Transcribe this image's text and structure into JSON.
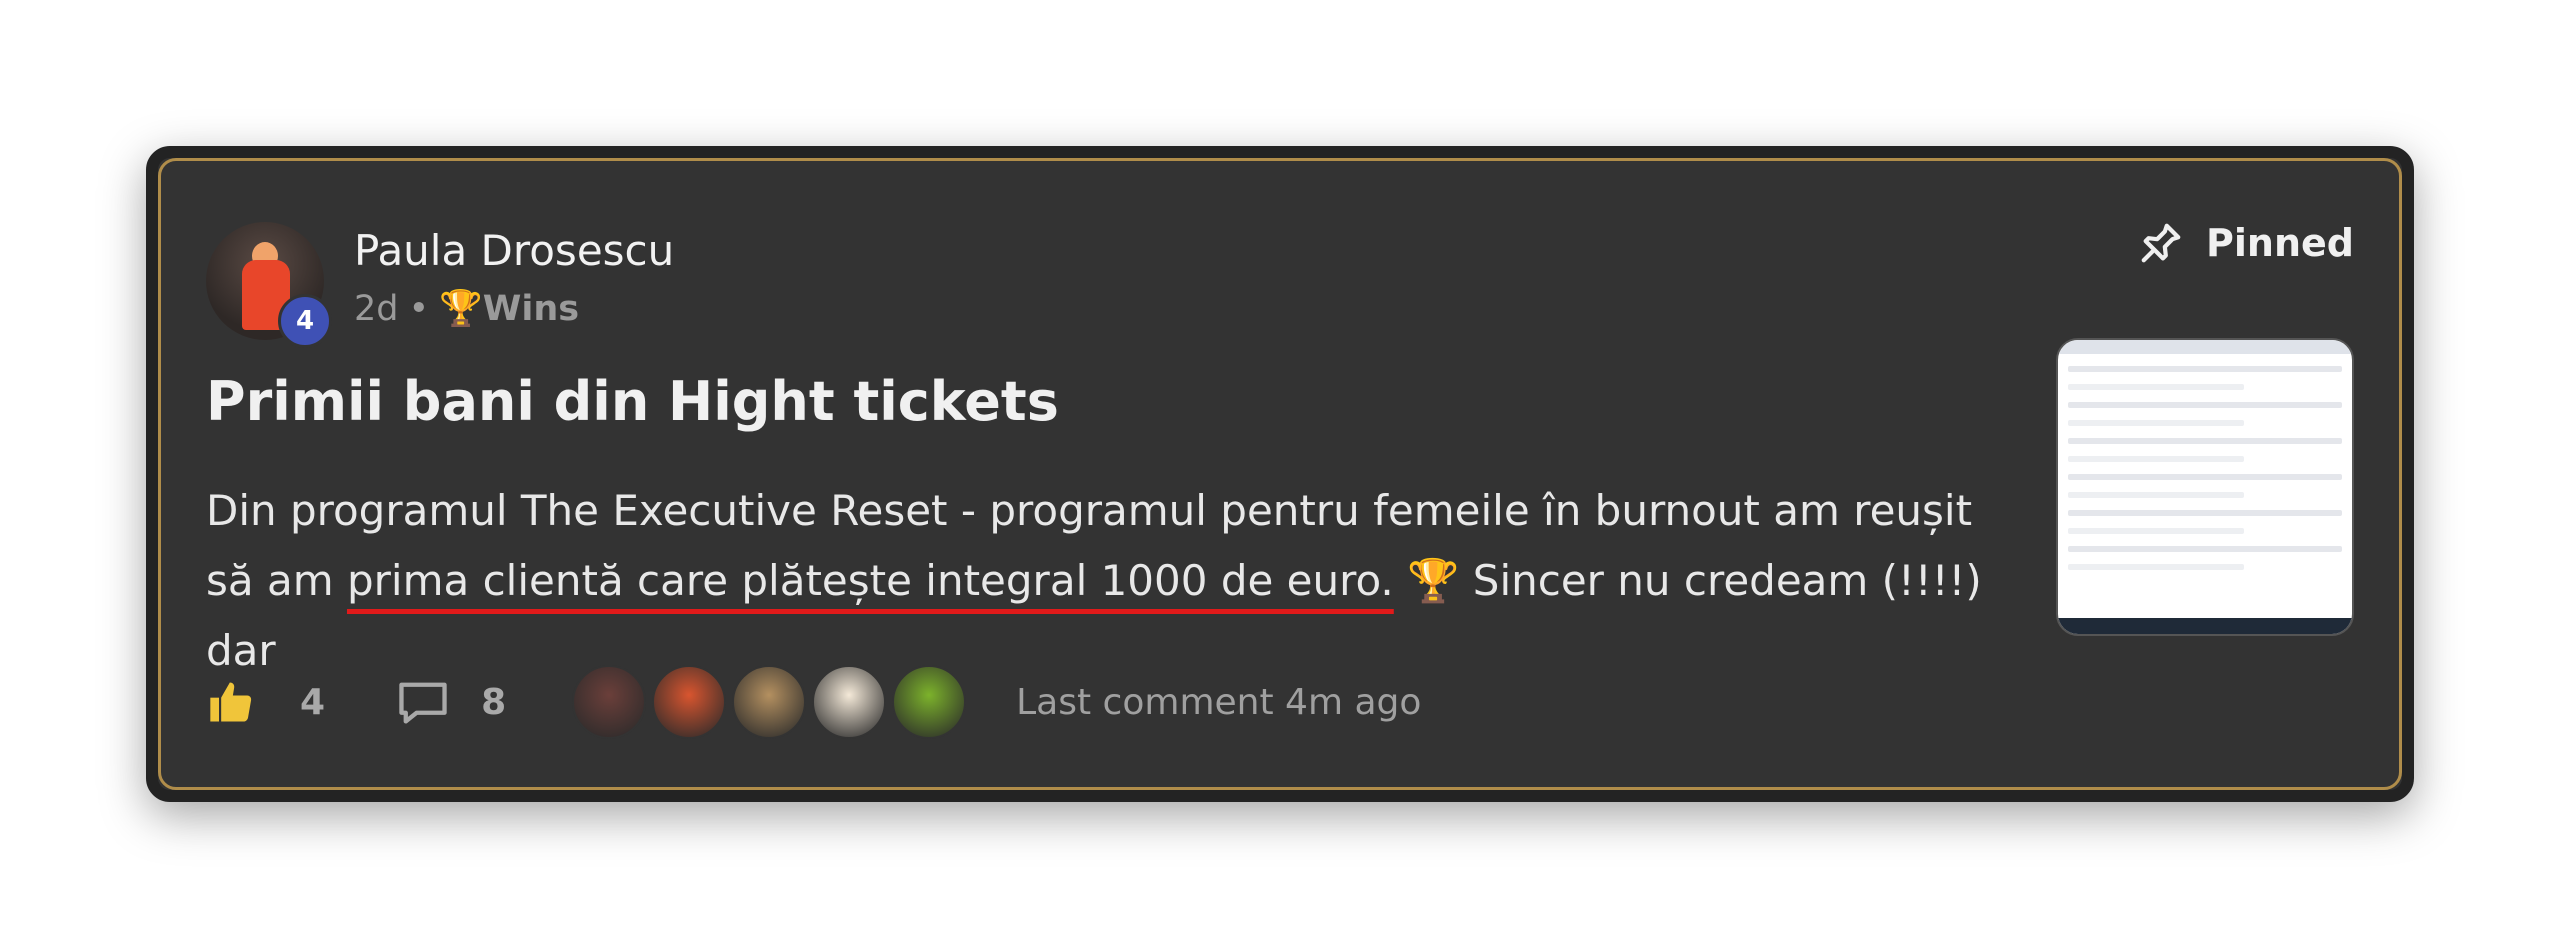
{
  "post": {
    "author": "Paula Drosescu",
    "level": "4",
    "time": "2d",
    "separator": "•",
    "category_emoji": "🏆",
    "category": "Wins",
    "pinned_label": "Pinned",
    "title": "Primii bani din Hight tickets",
    "body_line1": "Din programul The Executive Reset - programul pentru femeile în burnout am reușit",
    "body_line2_start": "să am ",
    "body_highlight": "prima clientă care plătește integral 1000 de euro.",
    "body_line2_end": " 🏆 Sincer nu credeam (!!!!) dar"
  },
  "footer": {
    "likes": "4",
    "comments": "8",
    "last_comment": "Last comment 4m ago",
    "commenter_avatars": [
      "#6b3f3a",
      "#d8552f",
      "#b49060",
      "#f4e9d8",
      "#7cb22b"
    ]
  },
  "colors": {
    "card": "#333333",
    "gold_border": "#b08d4a",
    "level_badge": "#3f51b5",
    "underline": "#e11a1a"
  }
}
